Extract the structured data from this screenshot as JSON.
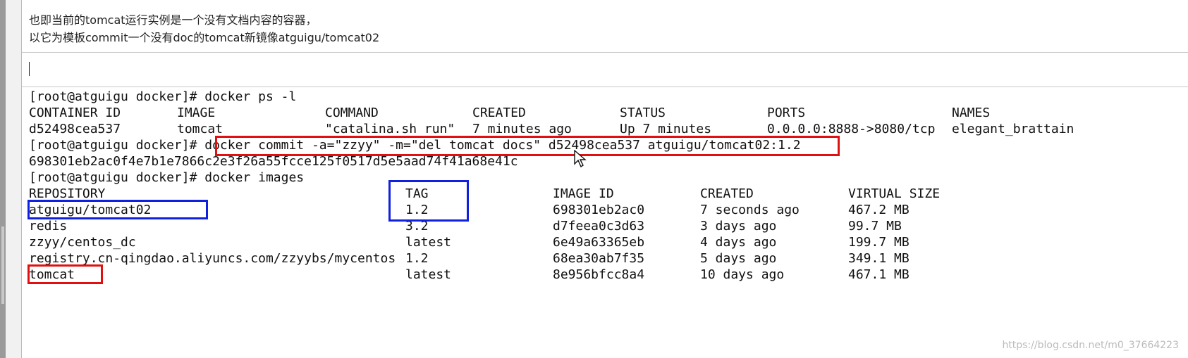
{
  "note": {
    "line1": "也即当前的tomcat运行实例是一个没有文档内容的容器，",
    "line2": "以它为模板commit一个没有doc的tomcat新镜像atguigu/tomcat02"
  },
  "terminal": {
    "cmd1": "[root@atguigu docker]# docker ps -l",
    "ps_headers": [
      "CONTAINER ID",
      "IMAGE",
      "COMMAND",
      "CREATED",
      "STATUS",
      "PORTS",
      "NAMES"
    ],
    "ps_row": [
      "d52498cea537",
      "tomcat",
      "\"catalina.sh run\"",
      "7 minutes ago",
      "Up 7 minutes",
      "0.0.0.0:8888->8080/tcp",
      "elegant_brattain"
    ],
    "prompt": "[root@atguigu docker]# ",
    "cmd2": "docker commit -a=\"zzyy\" -m=\"del tomcat docs\" d52498cea537 atguigu/tomcat02:1.2",
    "commit_hash": "698301eb2ac0f4e7b1e7866c2e3f26a55fcce125f0517d5e5aad74f41a68e41c",
    "cmd3": "[root@atguigu docker]# docker images",
    "img_headers": [
      "REPOSITORY",
      "TAG",
      "IMAGE ID",
      "CREATED",
      "VIRTUAL SIZE"
    ],
    "images": [
      [
        "atguigu/tomcat02",
        "1.2",
        "698301eb2ac0",
        "7 seconds ago",
        "467.2 MB"
      ],
      [
        "redis",
        "3.2",
        "d7feea0c3d63",
        "3 days ago",
        "99.7 MB"
      ],
      [
        "zzyy/centos_dc",
        "latest",
        "6e49a63365eb",
        "4 days ago",
        "199.7 MB"
      ],
      [
        "registry.cn-qingdao.aliyuncs.com/zzyybs/mycentos",
        "1.2",
        "68ea30ab7f35",
        "5 days ago",
        "349.1 MB"
      ],
      [
        "tomcat",
        "latest",
        "8e956bfcc8a4",
        "10 days ago",
        "467.1 MB"
      ]
    ]
  },
  "watermark": "https://blog.csdn.net/m0_37664223",
  "colors": {
    "highlight_red": "#e01010",
    "highlight_blue": "#1020e0"
  }
}
